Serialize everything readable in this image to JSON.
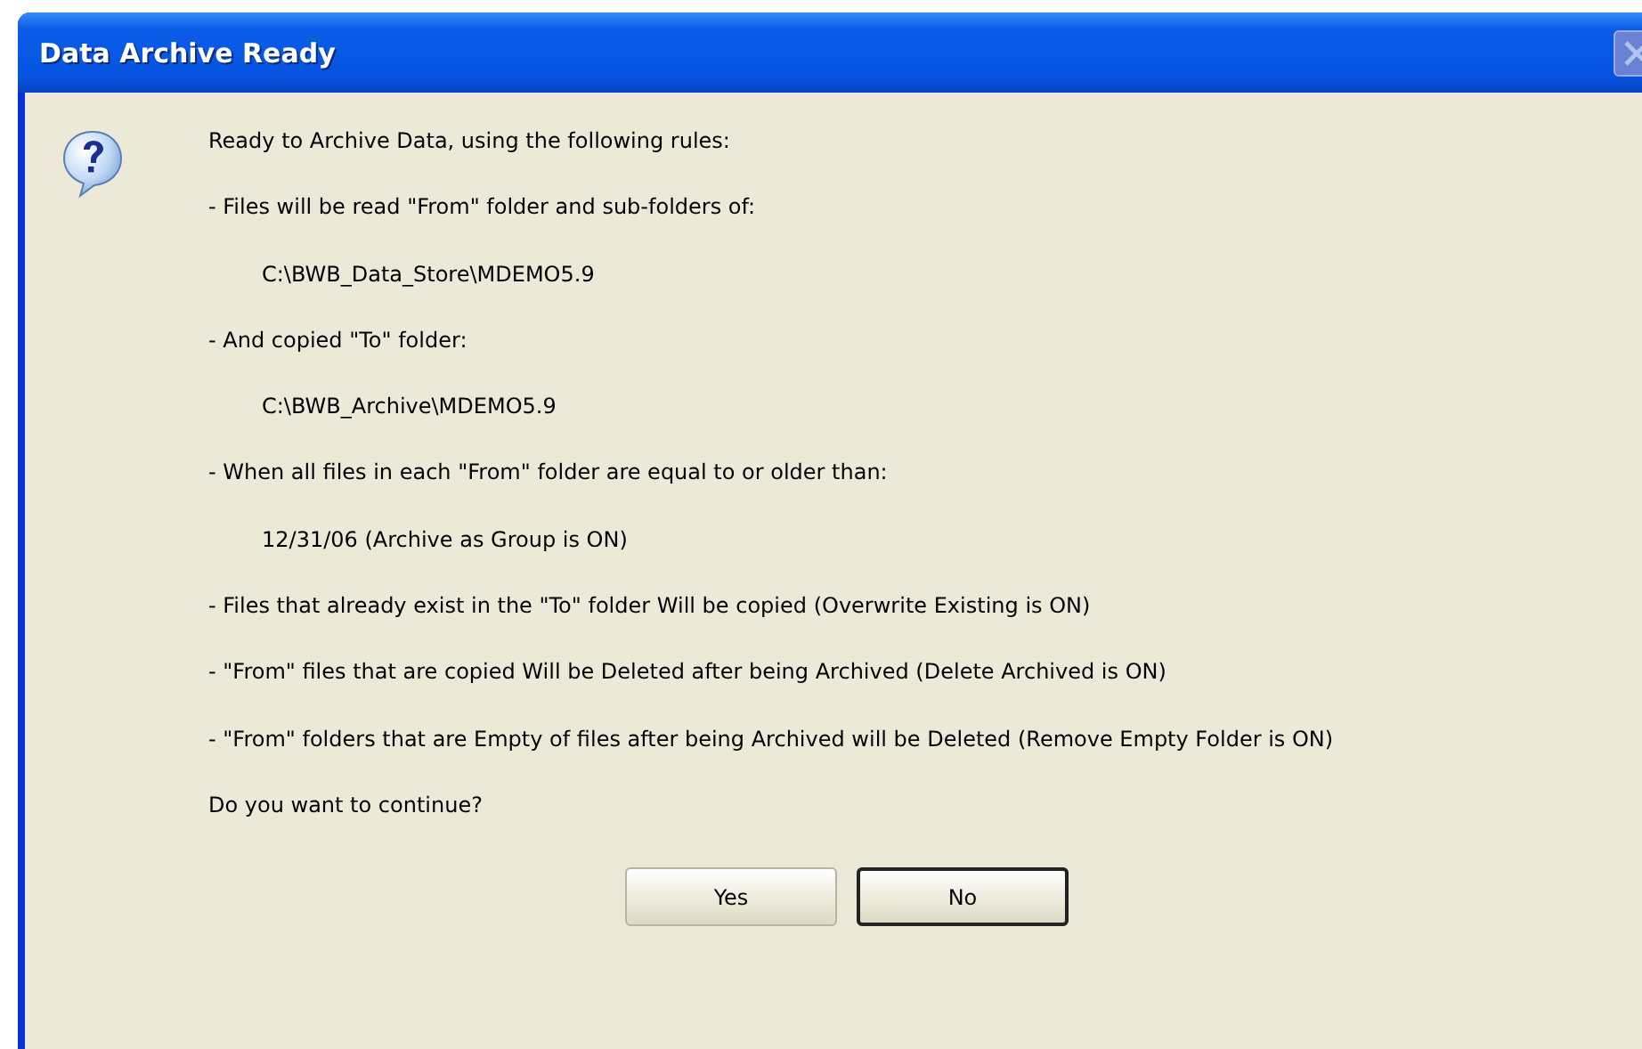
{
  "window": {
    "title": "Data Archive Ready",
    "close_disabled": true
  },
  "lines": [
    {
      "kind": "text",
      "text": "Ready to Archive Data, using the following rules:"
    },
    {
      "kind": "text",
      "text": "- Files will be read \"From\" folder and sub-folders of:"
    },
    {
      "kind": "path",
      "text": "C:\\BWB_Data_Store\\MDEMO5.9"
    },
    {
      "kind": "text",
      "text": "- And copied \"To\" folder:"
    },
    {
      "kind": "path",
      "text": "C:\\BWB_Archive\\MDEMO5.9"
    },
    {
      "kind": "text",
      "text": "- When all files in each \"From\" folder are equal to or older than:"
    },
    {
      "kind": "path",
      "text": "12/31/06 (Archive as Group is ON)"
    },
    {
      "kind": "text",
      "text": "- Files that already exist in the \"To\" folder Will be copied (Overwrite Existing is ON)"
    },
    {
      "kind": "text",
      "text": "- \"From\" files that are copied Will be Deleted after being Archived (Delete Archived is ON)"
    },
    {
      "kind": "text",
      "text": "- \"From\" folders that are Empty of files after being Archived will be Deleted (Remove Empty Folder is ON)"
    },
    {
      "kind": "text",
      "text": "Do you want to continue?"
    }
  ],
  "buttons": [
    {
      "label": "Yes",
      "default": false
    },
    {
      "label": "No",
      "default": true
    }
  ]
}
